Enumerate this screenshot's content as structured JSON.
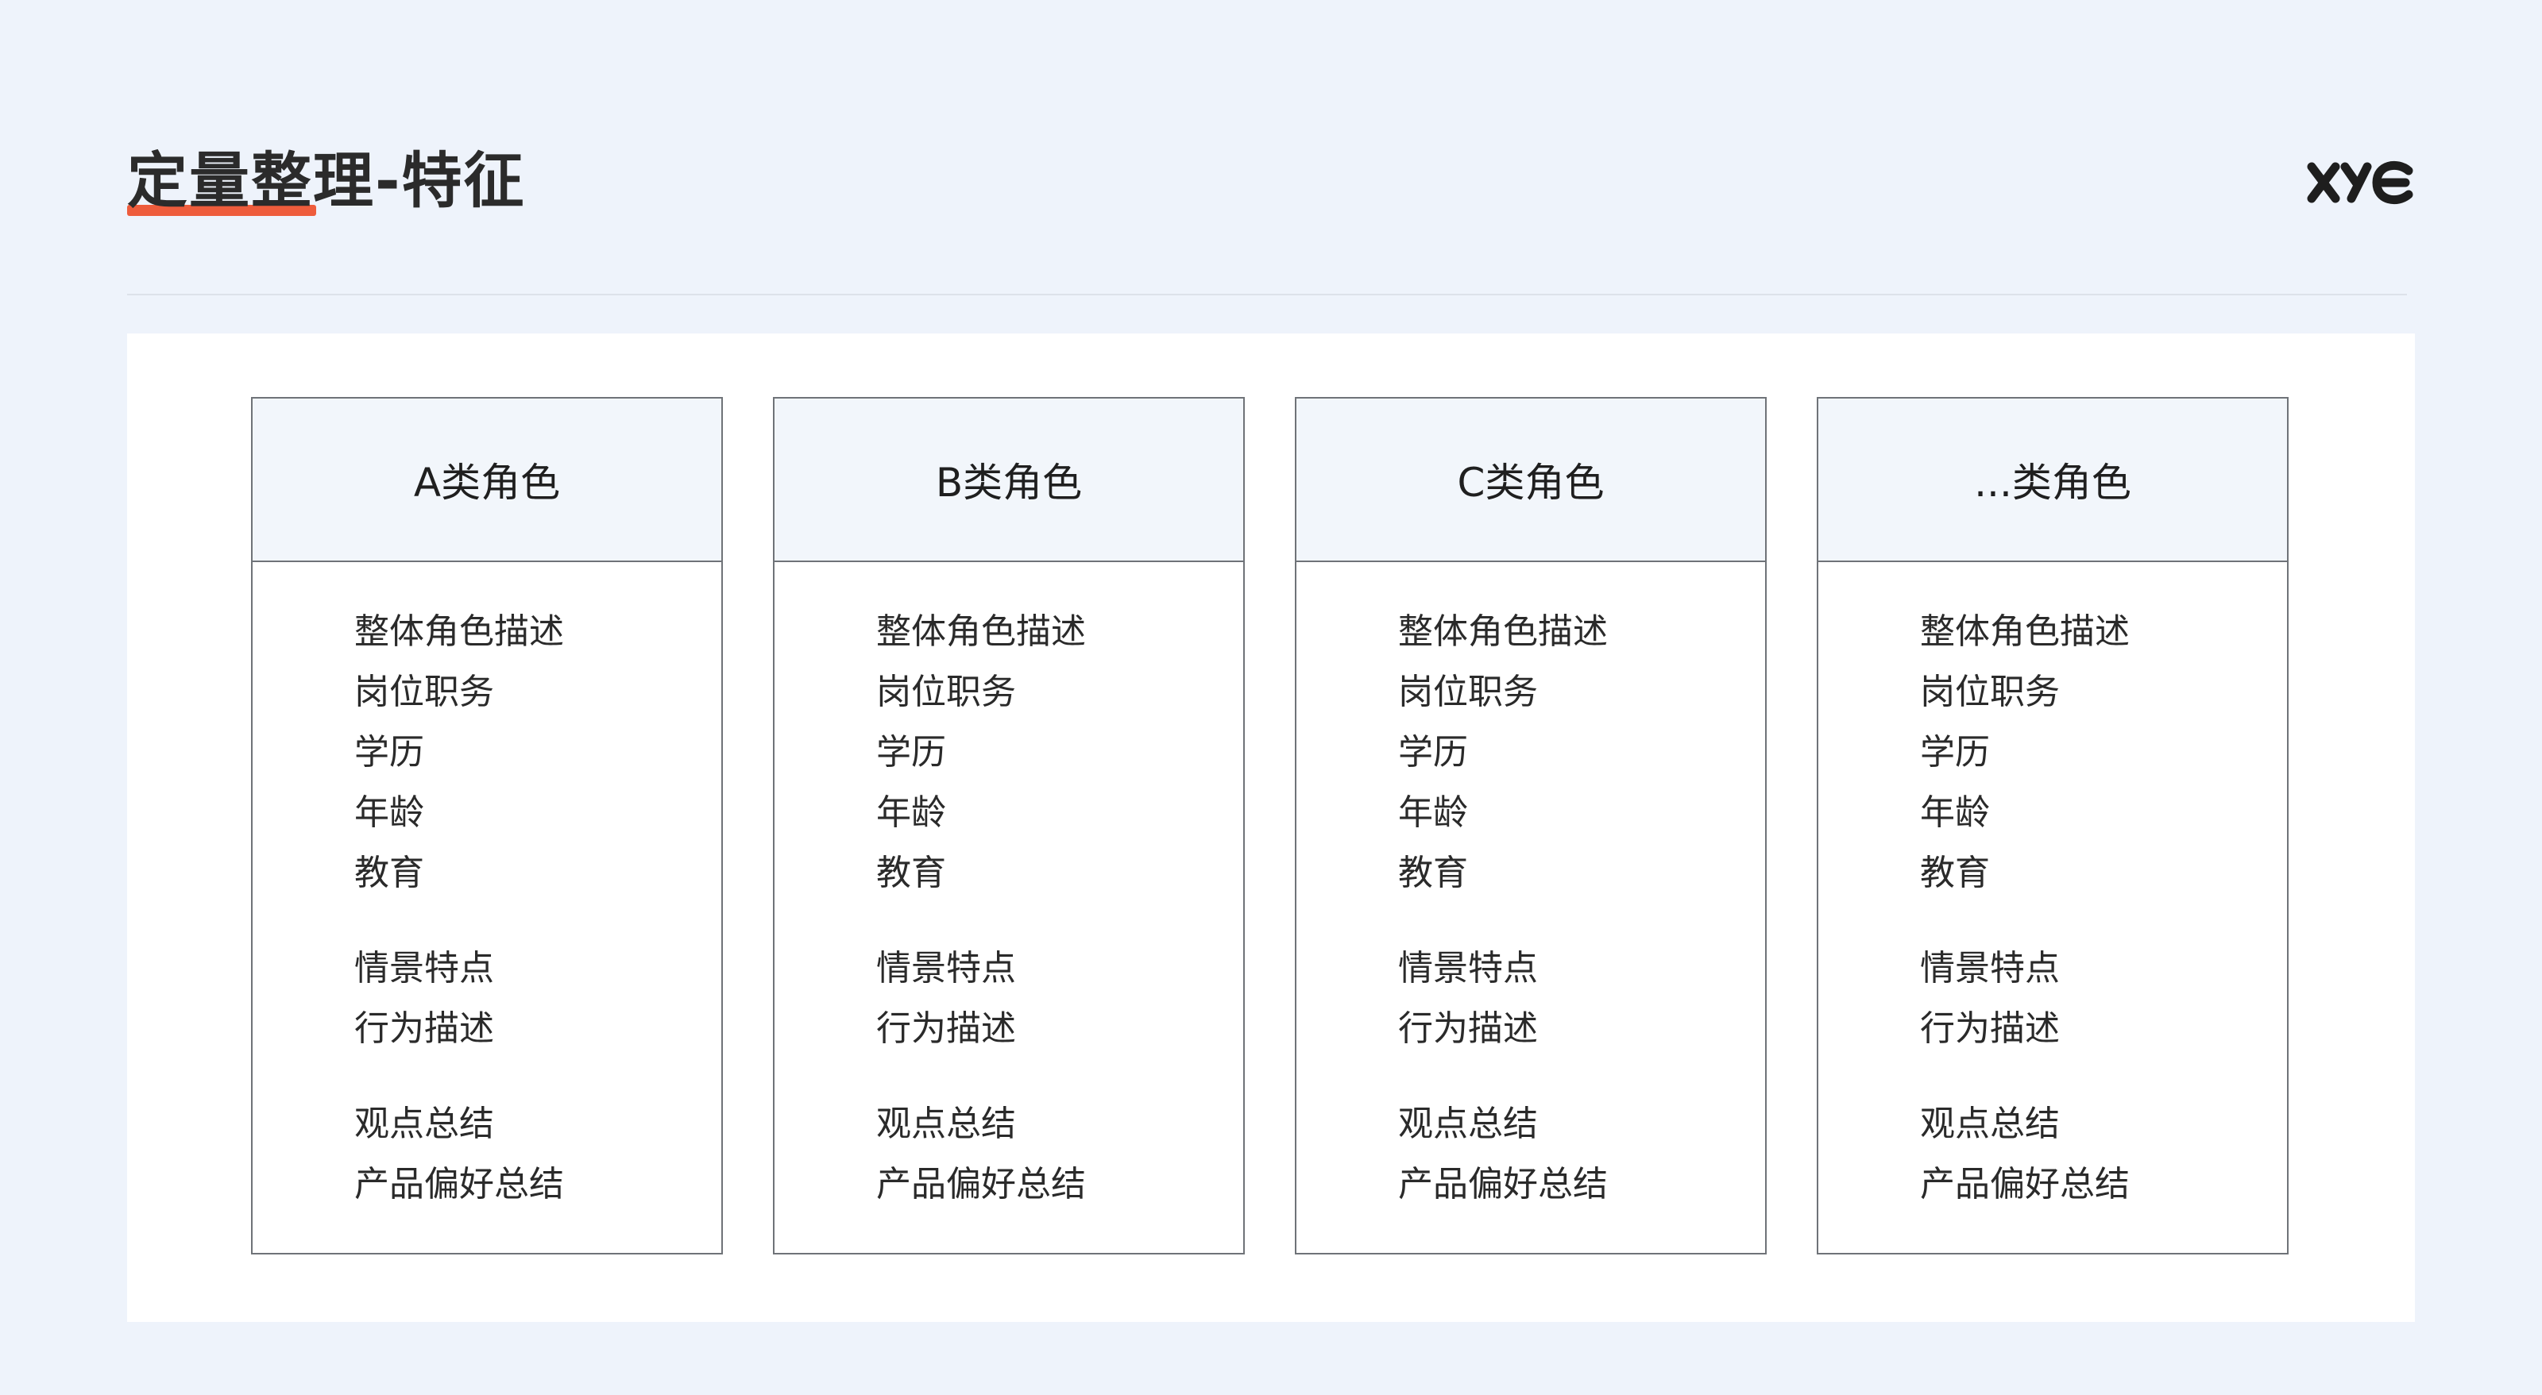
{
  "header": {
    "title": "定量整理-特征",
    "logo_text": "XYC"
  },
  "colors": {
    "background": "#eef3fb",
    "accent": "#ee5c3c",
    "card_header": "#f2f6fb",
    "card_border": "#6f7378"
  },
  "cards": [
    {
      "title": "A类角色",
      "groups": [
        [
          "整体角色描述",
          "岗位职务",
          "学历",
          "年龄",
          "教育"
        ],
        [
          "情景特点",
          "行为描述"
        ],
        [
          "观点总结",
          "产品偏好总结"
        ]
      ]
    },
    {
      "title": "B类角色",
      "groups": [
        [
          "整体角色描述",
          "岗位职务",
          "学历",
          "年龄",
          "教育"
        ],
        [
          "情景特点",
          "行为描述"
        ],
        [
          "观点总结",
          "产品偏好总结"
        ]
      ]
    },
    {
      "title": "C类角色",
      "groups": [
        [
          "整体角色描述",
          "岗位职务",
          "学历",
          "年龄",
          "教育"
        ],
        [
          "情景特点",
          "行为描述"
        ],
        [
          "观点总结",
          "产品偏好总结"
        ]
      ]
    },
    {
      "title": "...类角色",
      "groups": [
        [
          "整体角色描述",
          "岗位职务",
          "学历",
          "年龄",
          "教育"
        ],
        [
          "情景特点",
          "行为描述"
        ],
        [
          "观点总结",
          "产品偏好总结"
        ]
      ]
    }
  ]
}
